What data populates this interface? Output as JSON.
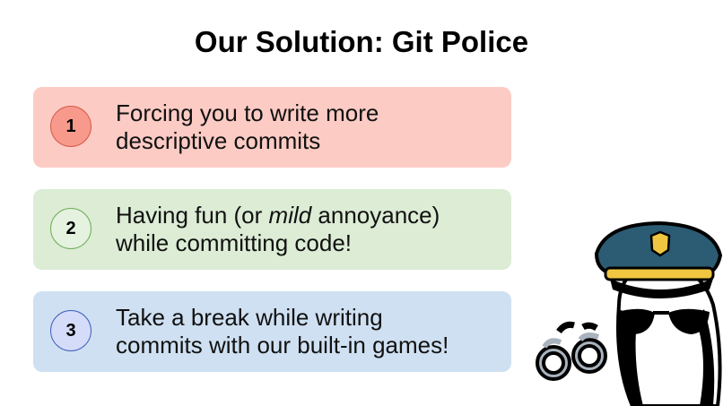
{
  "title": "Our Solution: Git Police",
  "colors": {
    "card_1_bg": "#fccbc4",
    "num_1_bg": "#f79a8c",
    "num_1_border": "#d85a4a",
    "card_2_bg": "#dcecd5",
    "num_2_bg": "#e5f2df",
    "num_2_border": "#6fae5b",
    "card_3_bg": "#cfe0f2",
    "num_3_bg": "#d5dcfa",
    "num_3_border": "#3f5fb8",
    "police_hat": "#2b5c73",
    "hat_band": "#f0c640",
    "handcuffs": "#a9b3bd"
  },
  "items": [
    {
      "number": "1",
      "line1": "Forcing you to write more",
      "line2": "descriptive commits"
    },
    {
      "number": "2",
      "line1_before": "Having fun (or ",
      "line1_em": "mild",
      "line1_after": " annoyance)",
      "line2": "while committing code!"
    },
    {
      "number": "3",
      "line1": "Take a break while writing",
      "line2": "commits with our built-in games!"
    }
  ],
  "mascot": {
    "icons": [
      "police-hat-icon",
      "sunglasses-icon",
      "handcuffs-icon"
    ]
  }
}
